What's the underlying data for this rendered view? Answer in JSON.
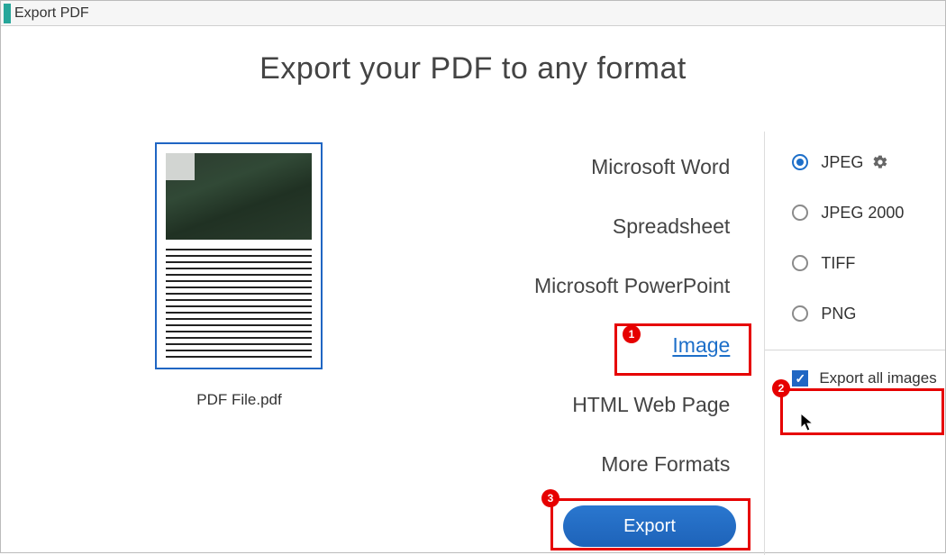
{
  "header": {
    "title": "Export PDF"
  },
  "main_title": "Export your PDF to any format",
  "preview": {
    "filename": "PDF File.pdf"
  },
  "formats": {
    "items": [
      {
        "label": "Microsoft Word",
        "selected": false
      },
      {
        "label": "Spreadsheet",
        "selected": false
      },
      {
        "label": "Microsoft PowerPoint",
        "selected": false
      },
      {
        "label": "Image",
        "selected": true
      },
      {
        "label": "HTML Web Page",
        "selected": false
      },
      {
        "label": "More Formats",
        "selected": false
      }
    ]
  },
  "subformats": {
    "items": [
      {
        "label": "JPEG",
        "selected": true,
        "gear": true
      },
      {
        "label": "JPEG 2000",
        "selected": false
      },
      {
        "label": "TIFF",
        "selected": false
      },
      {
        "label": "PNG",
        "selected": false
      }
    ],
    "export_all_label": "Export all images",
    "export_all_checked": true
  },
  "export_button": "Export",
  "annotations": {
    "a1": "1",
    "a2": "2",
    "a3": "3"
  }
}
